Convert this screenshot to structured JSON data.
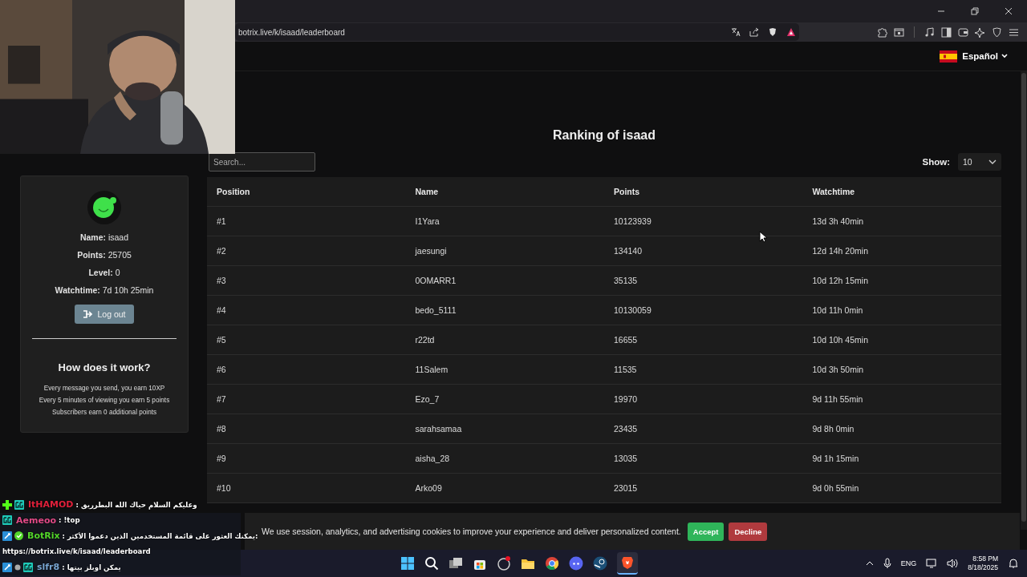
{
  "address_bar": {
    "url": "botrix.live/k/isaad/leaderboard"
  },
  "language": {
    "label": "Español"
  },
  "profile": {
    "lines": [
      "**Name:** isaad",
      "**Points:** 25705",
      "**Level:** 0",
      "**Watchtime:** 7d 10h 25min"
    ],
    "logout": "Log out"
  },
  "how_it_works": {
    "title": "How does it work?",
    "lines": [
      "Every message you send, you earn 10XP",
      "Every 5 minutes of viewing you earn 5 points",
      "Subscribers earn 0 additional points"
    ]
  },
  "ranking": {
    "title": "Ranking of isaad",
    "search": {
      "placeholder": "Search..."
    },
    "show": {
      "label": "Show:",
      "value": "10"
    },
    "columns": [
      "Position",
      "Name",
      "Points",
      "Watchtime"
    ],
    "rows": [
      [
        "#1",
        "I1Yara",
        "10123939",
        "13d 3h 40min"
      ],
      [
        "#2",
        "jaesungi",
        "134140",
        "12d 14h 20min"
      ],
      [
        "#3",
        "0OMARR1",
        "35135",
        "10d 12h 15min"
      ],
      [
        "#4",
        "bedo_5111",
        "10130059",
        "10d 11h 0min"
      ],
      [
        "#5",
        "r22td",
        "16655",
        "10d 10h 45min"
      ],
      [
        "#6",
        "11Salem",
        "11535",
        "10d 3h 50min"
      ],
      [
        "#7",
        "Ezo_7",
        "19970",
        "9d 11h 55min"
      ],
      [
        "#8",
        "sarahsamaa",
        "23435",
        "9d 8h 0min"
      ],
      [
        "#9",
        "aisha_28",
        "13035",
        "9d 1h 15min"
      ],
      [
        "#10",
        "Arko09",
        "23015",
        "9d 0h 55min"
      ]
    ]
  },
  "cookie_banner": {
    "text": "We use session, analytics, and advertising cookies to improve your experience and deliver personalized content.",
    "accept": "Accept",
    "decline": "Decline"
  },
  "chat": [
    {
      "kind": "message",
      "badges": [
        {
          "kind": "plus"
        },
        {
          "kind": "gg"
        }
      ],
      "user": "ItHAMOD",
      "color": "#e0203a",
      "message": ": وعليكم السلام حياك الله البطرريق"
    },
    {
      "kind": "message",
      "badges": [
        {
          "kind": "gg"
        }
      ],
      "user": "Aemeoo",
      "color": "#e04a86",
      "message": ": !top"
    },
    {
      "kind": "message",
      "badges": [
        {
          "kind": "mod"
        },
        {
          "kind": "verified"
        }
      ],
      "user": "BotRix",
      "color": "#53d62a",
      "message": ": يمكنك العثور على قائمة المستخدمين الذين دعموا الأكثر:"
    },
    {
      "kind": "continuation",
      "message": "https://botrix.live/k/isaad/leaderboard"
    },
    {
      "kind": "message",
      "badges": [
        {
          "kind": "mod"
        },
        {
          "kind": "dot"
        },
        {
          "kind": "gg"
        }
      ],
      "user": "slfr8",
      "color": "#79a6d2",
      "message": ": يمكن اوبلز بيتها"
    }
  ],
  "taskbar": {
    "language": "ENG",
    "time": "8:58 PM",
    "date": "8/18/2025"
  }
}
